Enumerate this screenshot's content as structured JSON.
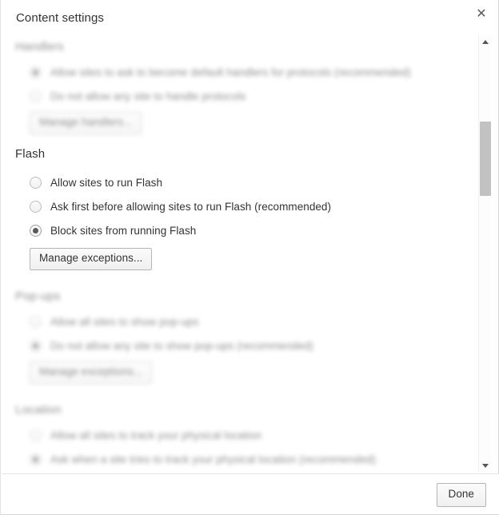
{
  "dialog": {
    "title": "Content settings",
    "close_icon": "close-icon",
    "close_glyph": "✕"
  },
  "scrollbar": {
    "up_icon": "chevron-up-icon",
    "down_icon": "chevron-down-icon",
    "thumb_name": "scrollbar-thumb"
  },
  "sections": [
    {
      "id": "handlers",
      "title": "Handlers",
      "focus": "blurred",
      "options": [
        {
          "label": "Allow sites to ask to become default handlers for protocols (recommended)",
          "checked": true
        },
        {
          "label": "Do not allow any site to handle protocols",
          "checked": false
        }
      ],
      "button": "Manage handlers..."
    },
    {
      "id": "flash",
      "title": "Flash",
      "focus": "sharp",
      "options": [
        {
          "label": "Allow sites to run Flash",
          "checked": false
        },
        {
          "label": "Ask first before allowing sites to run Flash (recommended)",
          "checked": false
        },
        {
          "label": "Block sites from running Flash",
          "checked": true
        }
      ],
      "button": "Manage exceptions..."
    },
    {
      "id": "popups",
      "title": "Pop-ups",
      "focus": "blurred",
      "options": [
        {
          "label": "Allow all sites to show pop-ups",
          "checked": false
        },
        {
          "label": "Do not allow any site to show pop-ups (recommended)",
          "checked": true
        }
      ],
      "button": "Manage exceptions..."
    },
    {
      "id": "location",
      "title": "Location",
      "focus": "blurred",
      "options": [
        {
          "label": "Allow all sites to track your physical location",
          "checked": false
        },
        {
          "label": "Ask when a site tries to track your physical location (recommended)",
          "checked": true
        }
      ],
      "button": null
    }
  ],
  "footer": {
    "done_label": "Done"
  },
  "colors": {
    "text": "#333333",
    "border": "#b5b5b5",
    "scrollbar_thumb": "#c2c2c2",
    "background": "#ffffff"
  }
}
